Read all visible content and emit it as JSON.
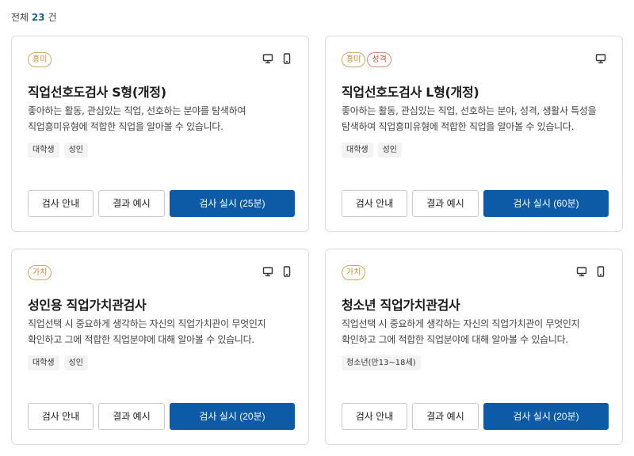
{
  "summary": {
    "prefix": "전체",
    "count": "23",
    "suffix": "건"
  },
  "cards": [
    {
      "badges": [
        "흥미"
      ],
      "devices": [
        "pc-icon",
        "mobile-icon"
      ],
      "title": "직업선호도검사 S형(개정)",
      "desc_lines": [
        "좋아하는 활동, 관심있는 직업, 선호하는 분야를 탐색하여",
        "직업흥미유형에 적합한 직업을 알아볼 수 있습니다."
      ],
      "tags": [
        "대학생",
        "성인"
      ],
      "buttons": {
        "guide": "검사 안내",
        "sample": "결과 예시",
        "start": "검사 실시 (25분)"
      }
    },
    {
      "badges": [
        "흥미",
        "성격"
      ],
      "devices": [
        "pc-icon"
      ],
      "title": "직업선호도검사 L형(개정)",
      "desc_lines": [
        "좋아하는 활동, 관심있는 직업, 선호하는 분야, 성격, 생활사 특성을",
        "탐색하여 직업흥미유형에 적합한 직업을 알아볼 수 있습니다."
      ],
      "tags": [
        "대학생",
        "성인"
      ],
      "buttons": {
        "guide": "검사 안내",
        "sample": "결과 예시",
        "start": "검사 실시 (60분)"
      }
    },
    {
      "badges": [
        "가치"
      ],
      "devices": [
        "pc-icon",
        "mobile-icon"
      ],
      "title": "성인용 직업가치관검사",
      "desc_lines": [
        "직업선택 시 중요하게 생각하는 자신의 직업가치관이 무엇인지",
        "확인하고 그에 적합한 직업분야에 대해 알아볼 수 있습니다."
      ],
      "tags": [
        "대학생",
        "성인"
      ],
      "buttons": {
        "guide": "검사 안내",
        "sample": "결과 예시",
        "start": "검사 실시 (20분)"
      }
    },
    {
      "badges": [
        "가치"
      ],
      "devices": [
        "pc-icon",
        "mobile-icon"
      ],
      "title": "청소년 직업가치관검사",
      "desc_lines": [
        "직업선택 시 중요하게 생각하는 자신의 직업가치관이 무엇인지",
        "확인하고 그에 적합한 직업분야에 대해 알아볼 수 있습니다."
      ],
      "tags": [
        "청소년(만13~18세)"
      ],
      "buttons": {
        "guide": "검사 안내",
        "sample": "결과 예시",
        "start": "검사 실시 (20분)"
      }
    }
  ]
}
